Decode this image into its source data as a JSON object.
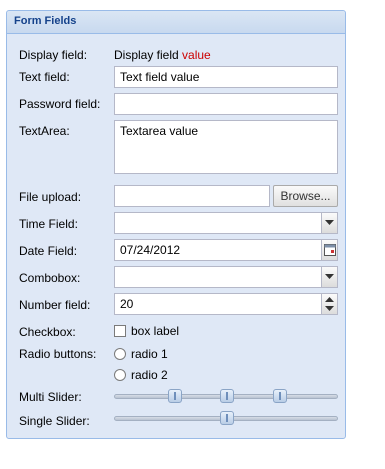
{
  "panel": {
    "title": "Form Fields"
  },
  "fields": {
    "display": {
      "label": "Display field:",
      "value_prefix": "Display field",
      "value_suffix": "value"
    },
    "text": {
      "label": "Text field:",
      "value": "Text field value"
    },
    "password": {
      "label": "Password field:",
      "value": ""
    },
    "textarea": {
      "label": "TextArea:",
      "value": "Textarea value"
    },
    "file": {
      "label": "File upload:",
      "value": "",
      "button": "Browse..."
    },
    "time": {
      "label": "Time Field:",
      "value": ""
    },
    "date": {
      "label": "Date Field:",
      "value": "07/24/2012"
    },
    "combo": {
      "label": "Combobox:",
      "value": ""
    },
    "number": {
      "label": "Number field:",
      "value": "20"
    },
    "checkbox": {
      "label": "Checkbox:",
      "box_label": "box label",
      "checked": false
    },
    "radios": {
      "label": "Radio buttons:",
      "options": [
        "radio 1",
        "radio 2"
      ],
      "selected": null
    },
    "multi_slider": {
      "label": "Multi Slider:",
      "values_fraction": [
        0.25,
        0.5,
        0.75
      ]
    },
    "single_slider": {
      "label": "Single Slider:",
      "value_fraction": 0.5
    }
  },
  "icons": {
    "combo_trigger": "chevron-down-icon",
    "date_trigger": "calendar-icon",
    "number_trigger": "spinner-icon"
  }
}
